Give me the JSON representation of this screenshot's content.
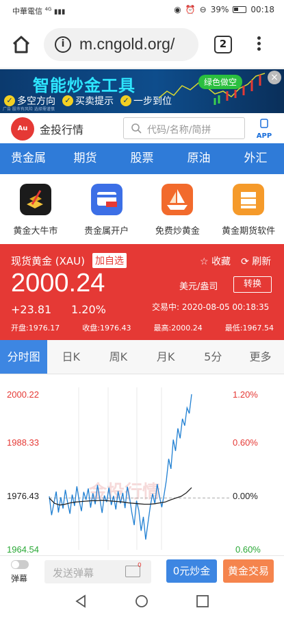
{
  "status_bar": {
    "carrier": "中華電信",
    "network": "4G",
    "battery": "39%",
    "time": "00:18"
  },
  "browser": {
    "url": "m.cngold.org/",
    "tab_count": "2"
  },
  "ad": {
    "title": "智能炒金工具",
    "features": [
      "多空方向",
      "买卖提示",
      "一步到位"
    ],
    "tag": "绿色做空",
    "disclaimer": "广告 股市有风险 选择需谨慎"
  },
  "site": {
    "brand": "金投行情",
    "logo_text": "Au",
    "search_placeholder": "代码/名称/简拼",
    "app_label": "APP"
  },
  "nav": [
    "贵金属",
    "期货",
    "股票",
    "原油",
    "外汇"
  ],
  "shortcuts": [
    {
      "label": "黄金大牛市",
      "color": "#1b1b1b",
      "icon": "gold-bars-icon"
    },
    {
      "label": "贵金属开户",
      "color": "#3c6fe6",
      "icon": "account-card-icon"
    },
    {
      "label": "免费炒黄金",
      "color": "#f26a2c",
      "icon": "gold-boat-icon"
    },
    {
      "label": "黄金期货软件",
      "color": "#f59a2a",
      "icon": "gold-ingot-icon"
    }
  ],
  "quote": {
    "name": "现货黄金 (XAU)",
    "add_watch": "加自选",
    "favorite": "收藏",
    "refresh": "刷新",
    "price": "2000.24",
    "unit": "美元/盎司",
    "convert": "转换",
    "change": "+23.81",
    "change_pct": "1.20%",
    "trade_time": "交易中: 2020-08-05 00:18:35",
    "open": "开盘:1976.17",
    "prev_close": "收盘:1976.43",
    "high": "最高:2000.24",
    "low": "最低:1967.54",
    "up_color": "#e53935"
  },
  "period_tabs": [
    "分时图",
    "日K",
    "周K",
    "月K",
    "5分",
    "更多"
  ],
  "chart_data": {
    "type": "line",
    "y_labels_left": [
      "2000.22",
      "1988.33",
      "1976.43",
      "1964.54"
    ],
    "y_labels_right": [
      "1.20%",
      "0.60%",
      "0.00%",
      "0.60%"
    ],
    "ylim": [
      1964.54,
      2000.22
    ],
    "baseline": 1976.43,
    "watermark": "金投行情",
    "series": [
      {
        "values": [
          1976.8,
          1972.5,
          1975.2,
          1977.9,
          1973.1,
          1976.6,
          1974.0,
          1978.3,
          1975.4,
          1972.8,
          1977.2,
          1974.6,
          1979.1,
          1975.9,
          1973.4,
          1977.8,
          1976.0,
          1978.6,
          1974.2,
          1977.5,
          1975.0,
          1979.4,
          1976.3,
          1973.0,
          1977.0,
          1975.5,
          1978.8,
          1974.8,
          1976.9,
          1973.8,
          1978.0,
          1975.2,
          1977.6,
          1974.1,
          1979.0,
          1976.4,
          1972.9,
          1970.2,
          1975.8,
          1973.6,
          1968.9,
          1972.1,
          1966.9,
          1970.8,
          1974.5,
          1977.4,
          1975.1,
          1979.6,
          1976.8,
          1974.3,
          1977.1,
          1980.5,
          1985.4,
          1983.1,
          1989.8,
          1987.2,
          1992.4,
          1990.1,
          1994.6,
          1993.0,
          1997.1,
          1995.8,
          2000.2
        ]
      },
      {
        "values": [
          1976.4,
          1975.2,
          1974.8,
          1975.0,
          1975.3,
          1975.5,
          1975.6,
          1975.7,
          1975.8,
          1975.8,
          1975.9,
          1975.8,
          1975.7,
          1975.6,
          1975.5,
          1975.3,
          1975.2,
          1975.1,
          1975.0,
          1975.0,
          1975.1,
          1975.3,
          1975.5,
          1976.0,
          1976.4,
          1976.8,
          1977.6,
          1978.8
        ]
      }
    ]
  },
  "bottom_bar": {
    "danmu_label": "弹幕",
    "input_placeholder": "发送弹幕",
    "msg_count": "0",
    "btn_blue": "0元炒金",
    "btn_orange": "黄金交易"
  }
}
